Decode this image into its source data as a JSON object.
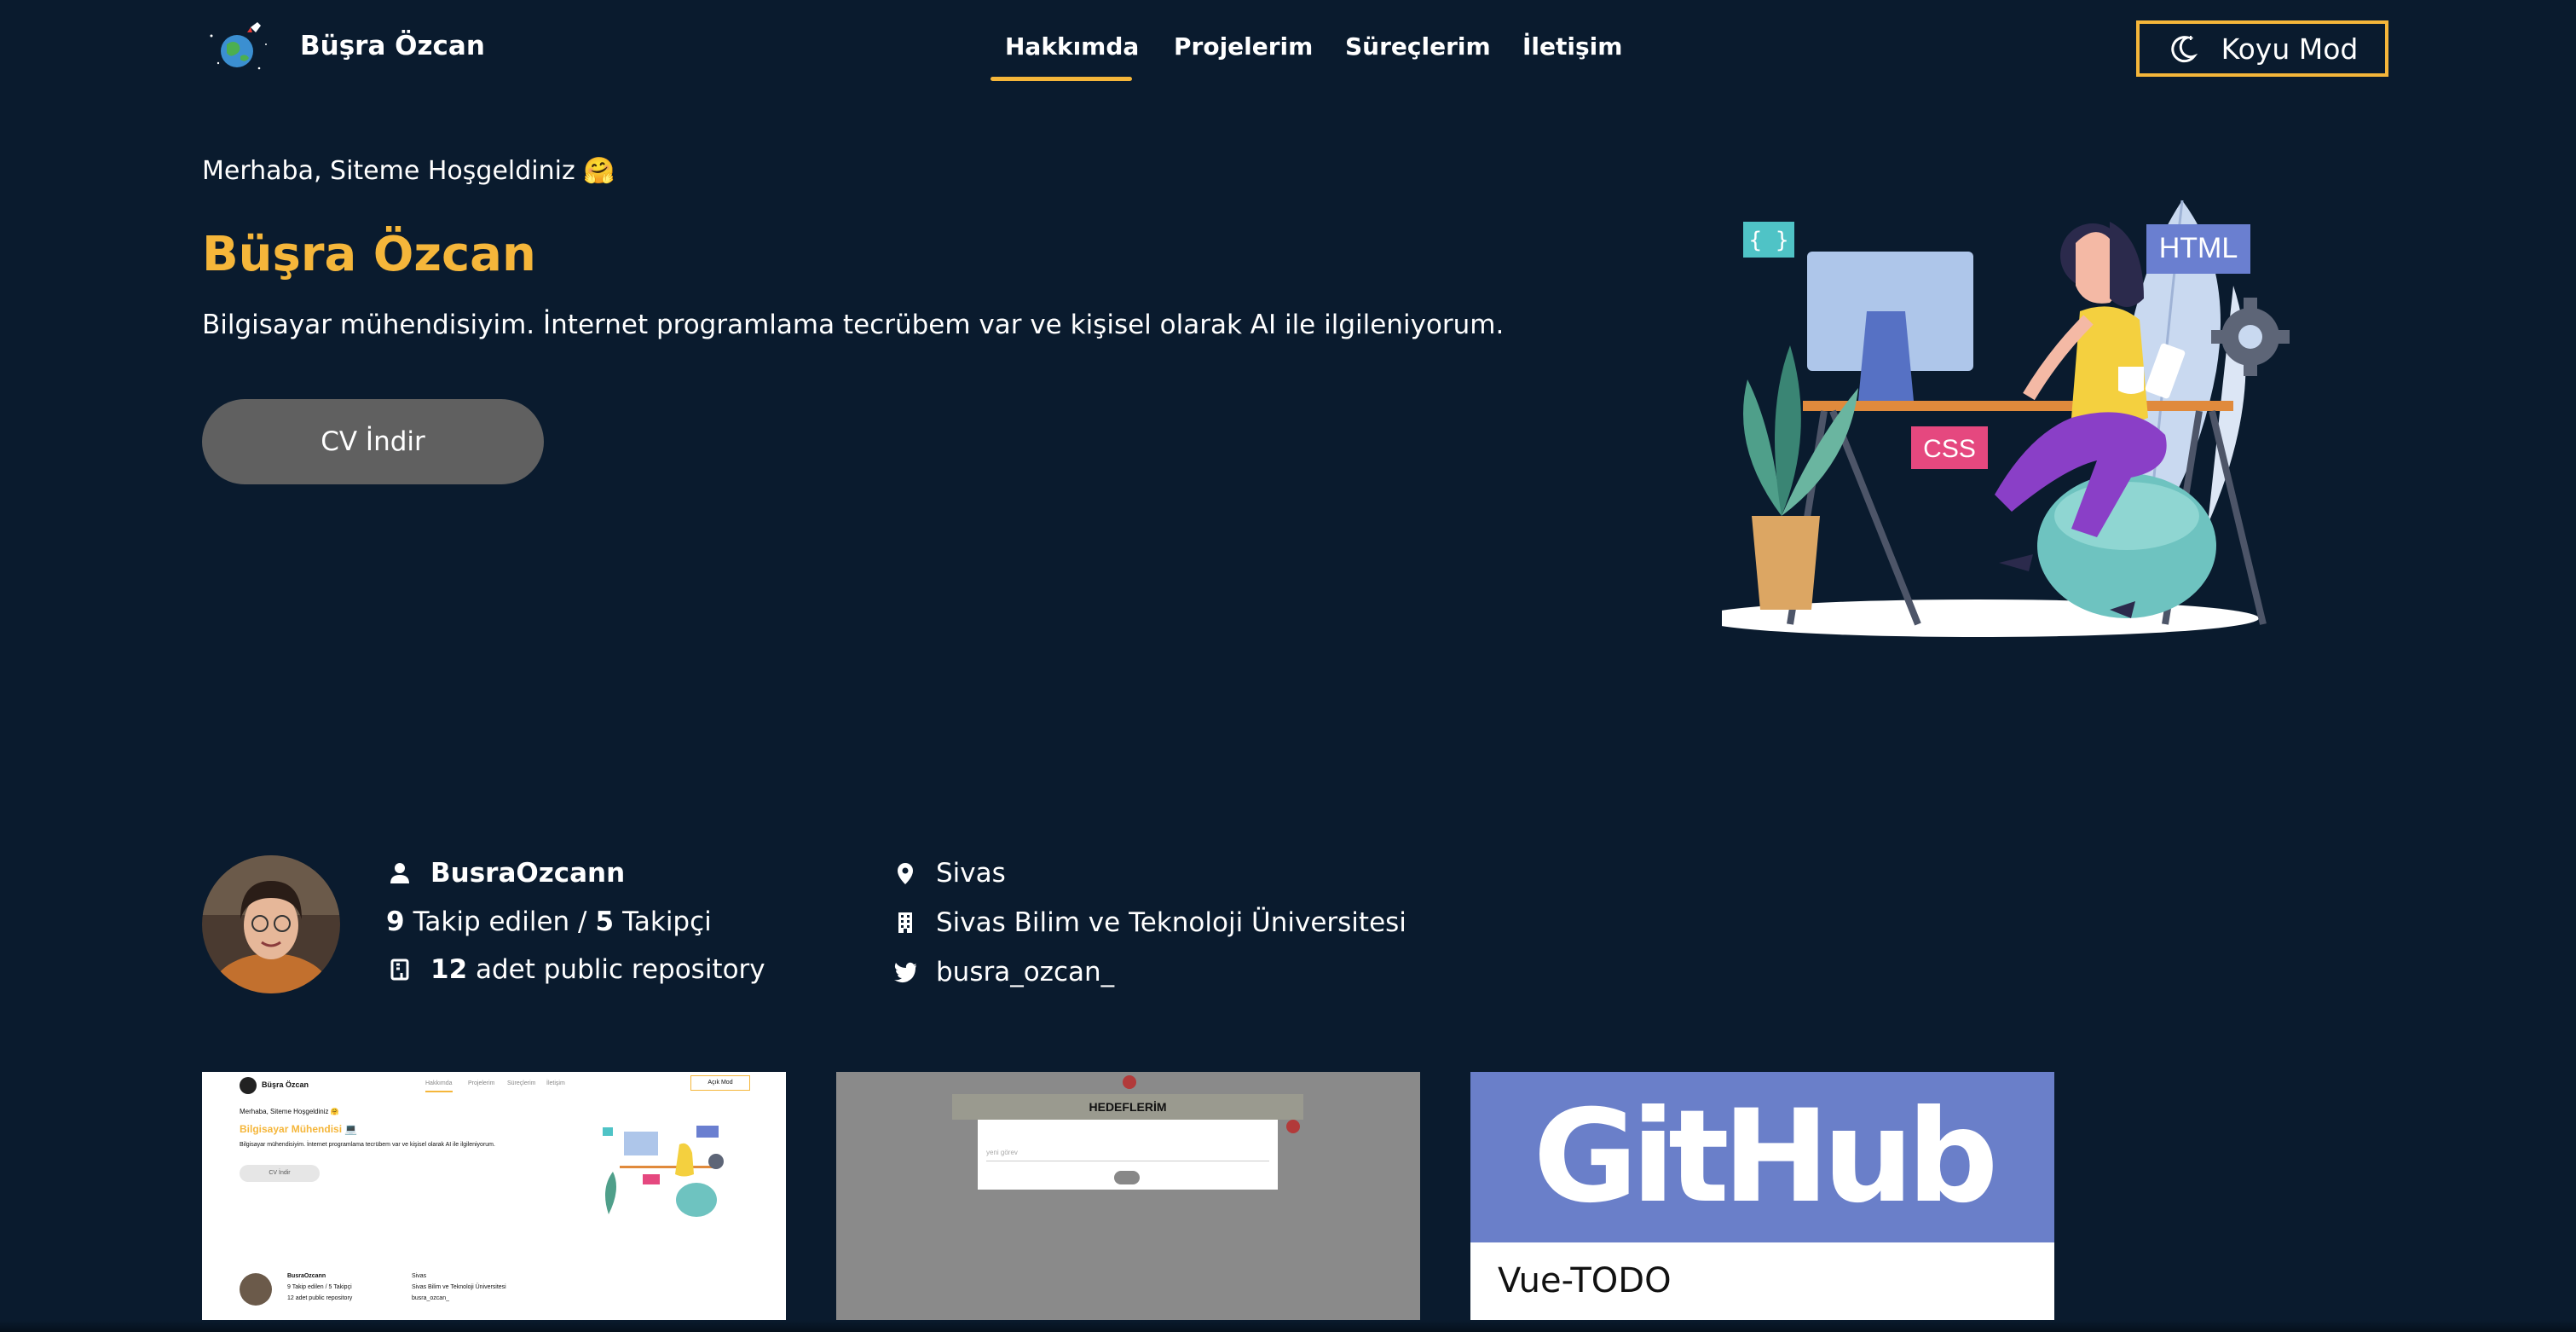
{
  "header": {
    "brand_name": "Büşra Özcan",
    "nav": [
      {
        "label": "Hakkımda",
        "active": true
      },
      {
        "label": "Projelerim",
        "active": false
      },
      {
        "label": "Süreçlerim",
        "active": false
      },
      {
        "label": "İletişim",
        "active": false
      }
    ],
    "mode_button": "Koyu Mod"
  },
  "hero": {
    "greeting": "Merhaba, Siteme Hoşgeldiniz 🤗",
    "name": "Büşra Özcan",
    "description": "Bilgisayar mühendisiyim. İnternet programlama tecrübem var ve kişisel olarak AI ile ilgileniyorum.",
    "cv_button": "CV İndir",
    "illustration_labels": {
      "braces": "{ }",
      "html": "HTML",
      "css": "CSS"
    }
  },
  "profile": {
    "username": "BusraOzcann",
    "following_count": "9",
    "following_label": "Takip edilen /",
    "followers_count": "5",
    "followers_label": "Takipçi",
    "repo_count": "12",
    "repo_label": "adet public repository",
    "location": "Sivas",
    "company": "Sivas Bilim ve Teknoloji Üniversitesi",
    "twitter": "busra_ozcan_"
  },
  "projects": [
    {
      "mini": {
        "brand": "Büşra Özcan",
        "nav": [
          "Hakkımda",
          "Projelerim",
          "Süreçlerim",
          "İletişim"
        ],
        "mode": "Açık Mod",
        "greeting": "Merhaba, Siteme Hoşgeldiniz 🤗",
        "title": "Bilgisayar Mühendisi 💻",
        "desc": "Bilgisayar mühendisiyim. İnternet programlama tecrübem var ve kişisel olarak AI ile ilgileniyorum.",
        "cv": "CV İndir",
        "username": "BusraOzcann",
        "follow": "9 Takip edilen / 5 Takipçi",
        "repos": "12 adet public repository",
        "city": "Sivas",
        "school": "Sivas Bilim ve Teknoloji Üniversitesi",
        "twitter": "busra_ozcan_"
      }
    },
    {
      "mini_title": "HEDEFLERİM",
      "mini_input_placeholder": "yeni görev"
    },
    {
      "banner": "GitHub",
      "title": "Vue-TODO"
    }
  ],
  "colors": {
    "background": "#0a1b2e",
    "accent": "#f5b63a",
    "cv_button": "#606060",
    "github_banner": "#6a7fc9"
  }
}
